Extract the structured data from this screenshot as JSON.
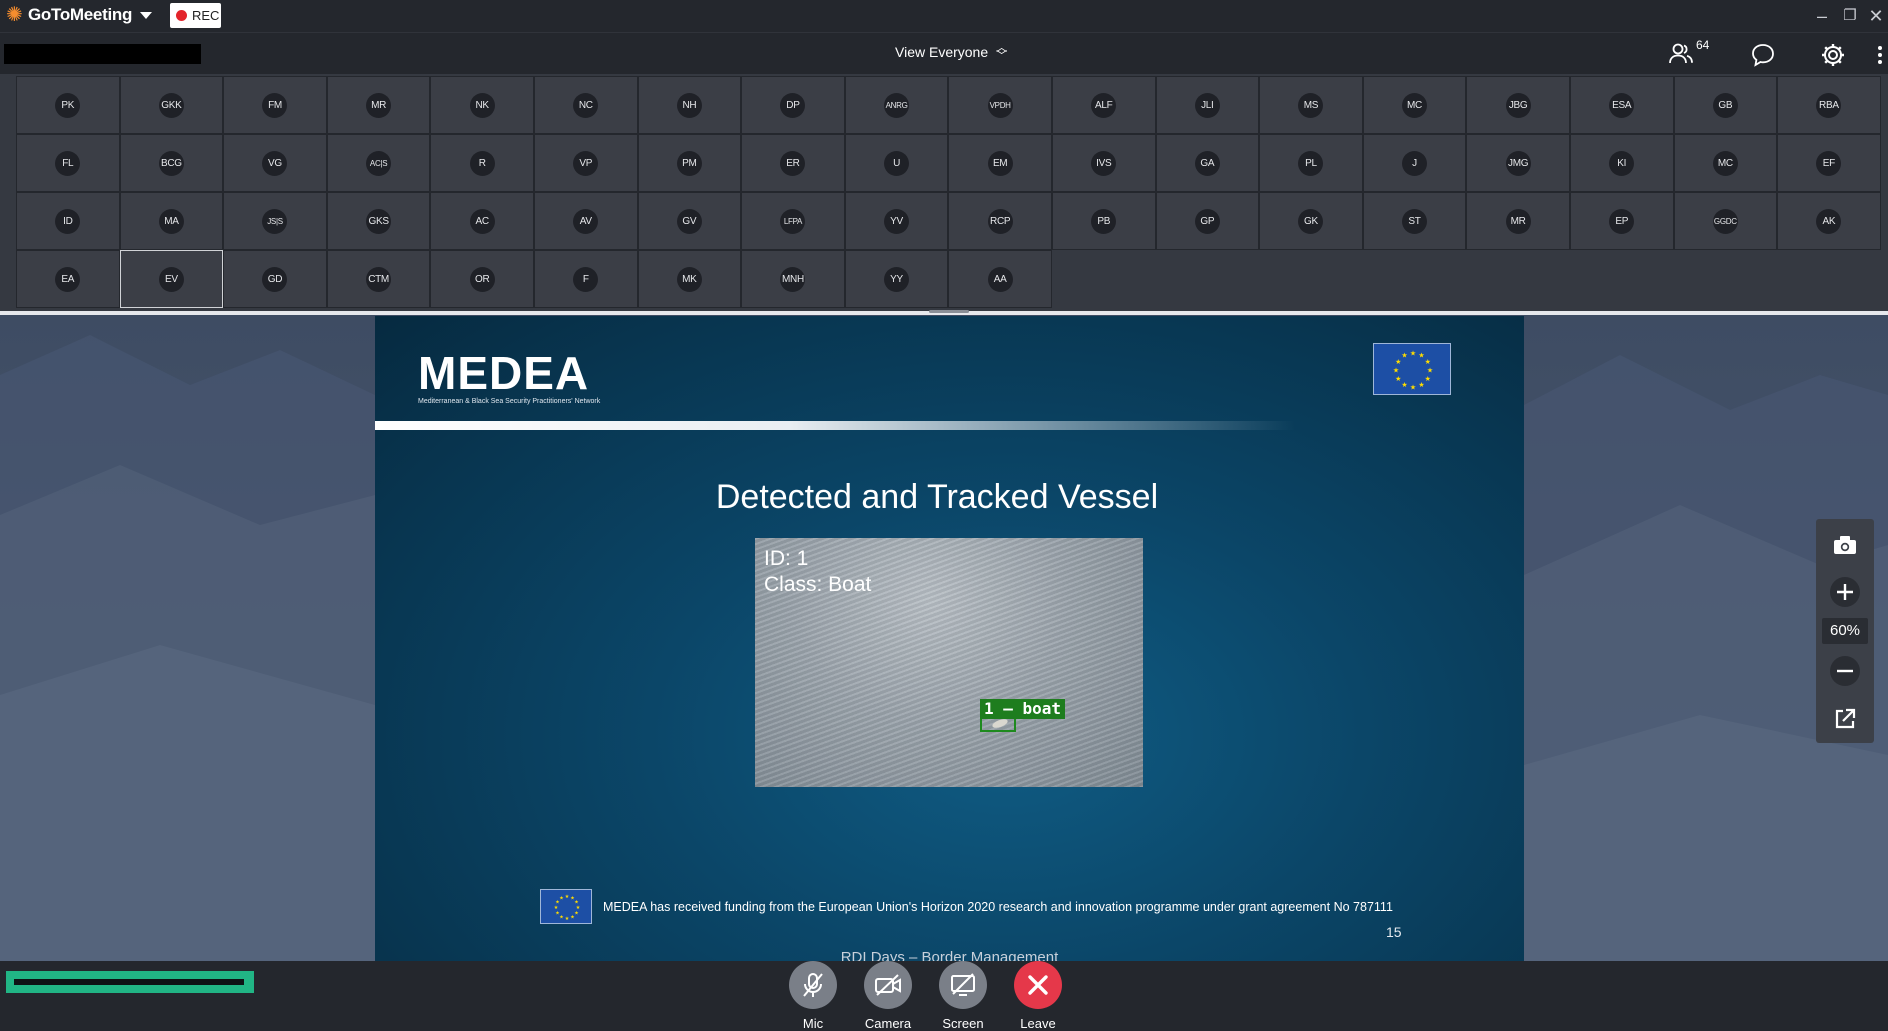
{
  "app": {
    "name": "GoToMeeting",
    "rec_label": "REC"
  },
  "toolbar": {
    "view_selector": "View Everyone",
    "attendee_count": "64"
  },
  "grid": {
    "rows": [
      [
        "PK",
        "GKK",
        "FM",
        "MR",
        "NK",
        "NC",
        "NH",
        "DP",
        "ANRG",
        "VPDH",
        "ALF",
        "JLI",
        "MS",
        "MC",
        "JBG",
        "ESA",
        "GB",
        "RBA"
      ],
      [
        "FL",
        "BCG",
        "VG",
        "AC|S",
        "R",
        "VP",
        "PM",
        "ER",
        "U",
        "EM",
        "IVS",
        "GA",
        "PL",
        "J",
        "JMG",
        "KI",
        "MC",
        "EF"
      ],
      [
        "ID",
        "MA",
        "JS|S",
        "GKS",
        "AC",
        "AV",
        "GV",
        "LFPA",
        "YV",
        "RCP",
        "PB",
        "GP",
        "GK",
        "ST",
        "MR",
        "EP",
        "GGDC",
        "AK"
      ],
      [
        "EA",
        "EV",
        "GD",
        "CTM",
        "OR",
        "F",
        "MK",
        "MNH",
        "YY",
        "AA"
      ]
    ],
    "selected": "EV"
  },
  "slide": {
    "logo_text": "MEDEA",
    "logo_subtitle": "Mediterranean & Black Sea Security Practitioners' Network",
    "title": "Detected and Tracked Vessel",
    "overlay_id": "ID: 1",
    "overlay_class": "Class: Boat",
    "detection_label": "1 — boat",
    "footer_text": "MEDEA has received funding from the European Union's Horizon 2020 research and innovation programme under grant agreement No 787111",
    "page_number": "15",
    "event_name": "RDI Days – Border Management"
  },
  "zoom": {
    "level": "60%"
  },
  "controls": {
    "mic": "Mic",
    "camera": "Camera",
    "screen": "Screen",
    "leave": "Leave"
  },
  "colors": {
    "leave": "#e5384a",
    "control": "#7a7f88",
    "meter": "#21b585"
  }
}
